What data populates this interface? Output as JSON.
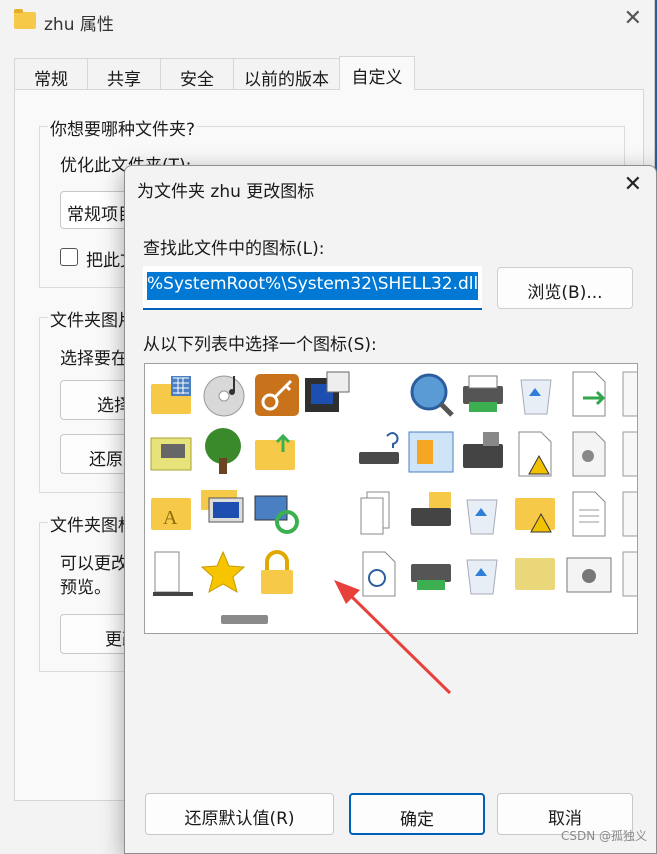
{
  "outer": {
    "title": "zhu 属性",
    "close": "✕",
    "tabs": [
      "常规",
      "共享",
      "安全",
      "以前的版本",
      "自定义"
    ],
    "group1_title": "你想要哪种文件夹?",
    "optimize_label": "优化此文件夹(T):",
    "optimize_value": "常规项目",
    "checkbox_label": "把此文件夹",
    "group2_title": "文件夹图片",
    "choose_text": "选择要在",
    "choose_btn": "选择",
    "restore_btn": "还原",
    "group3_title": "文件夹图标",
    "can_change": "可以更改",
    "preview": "预览。",
    "change_btn": "更改"
  },
  "dialog": {
    "title": "为文件夹 zhu 更改图标",
    "close": "✕",
    "find_label": "查找此文件中的图标(L):",
    "path_value": "%SystemRoot%\\System32\\SHELL32.dll",
    "browse": "浏览(B)...",
    "list_label": "从以下列表中选择一个图标(S):",
    "restore_default": "还原默认值(R)",
    "ok": "确定",
    "cancel": "取消"
  },
  "icons": [
    "folder-grid-icon",
    "cd-icon",
    "key-icon",
    "monitor-window-icon",
    "magnifier-globe-icon",
    "printer-icon",
    "recycle-bin-icon",
    "document-arrow-icon",
    "gear-doc-icon",
    "folder-drive-icon",
    "tree-icon",
    "folder-upload-icon",
    "drive-question-icon",
    "control-panel-icon",
    "fax-printer-icon",
    "document-warning-icon",
    "settings-doc-icon",
    "font-doc-icon",
    "folder-font-icon",
    "computer-folder-icon",
    "sync-monitor-icon",
    "documents-stack-icon",
    "printer-folder-icon",
    "recycle-bin-full-icon",
    "folder-warning-icon",
    "text-doc-icon",
    "font-doc-icon",
    "server-icon",
    "star-icon",
    "lock-icon",
    "search-doc-icon",
    "printer-green-icon",
    "recycle-bin-icon",
    "folder-pen-icon",
    "settings-window-icon",
    "font-doc-icon"
  ],
  "watermark": "CSDN @孤独义",
  "colors": {
    "accent": "#0078d4",
    "annotation": "#e8413b",
    "folder": "#f7c948"
  }
}
